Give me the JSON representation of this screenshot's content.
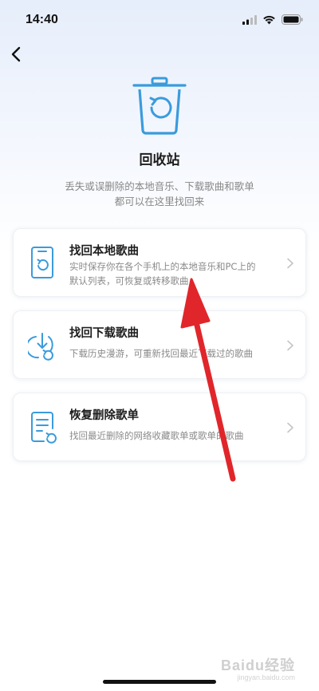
{
  "status_bar": {
    "time": "14:40"
  },
  "header": {
    "back_icon": "chevron-left-icon"
  },
  "hero": {
    "icon": "trash-restore-icon",
    "title": "回收站",
    "subtitle_line1": "丢失或误删除的本地音乐、下载歌曲和歌单",
    "subtitle_line2": "都可以在这里找回来"
  },
  "options": [
    {
      "icon": "phone-restore-icon",
      "title": "找回本地歌曲",
      "desc_line1": "实时保存你在各个手机上的本地音乐和PC上的",
      "desc_line2": "默认列表，可恢复或转移歌曲"
    },
    {
      "icon": "download-restore-icon",
      "title": "找回下载歌曲",
      "desc_line1": "下载历史漫游，可重新找回最近下载过的歌曲"
    },
    {
      "icon": "playlist-restore-icon",
      "title": "恢复删除歌单",
      "desc_line1": "找回最近删除的网络收藏歌单或歌单的歌曲"
    }
  ],
  "watermark": {
    "text": "Baidu经验",
    "sub": "jingyan.baidu.com"
  },
  "colors": {
    "accent": "#3a9bdc",
    "arrow": "#e0262b"
  }
}
